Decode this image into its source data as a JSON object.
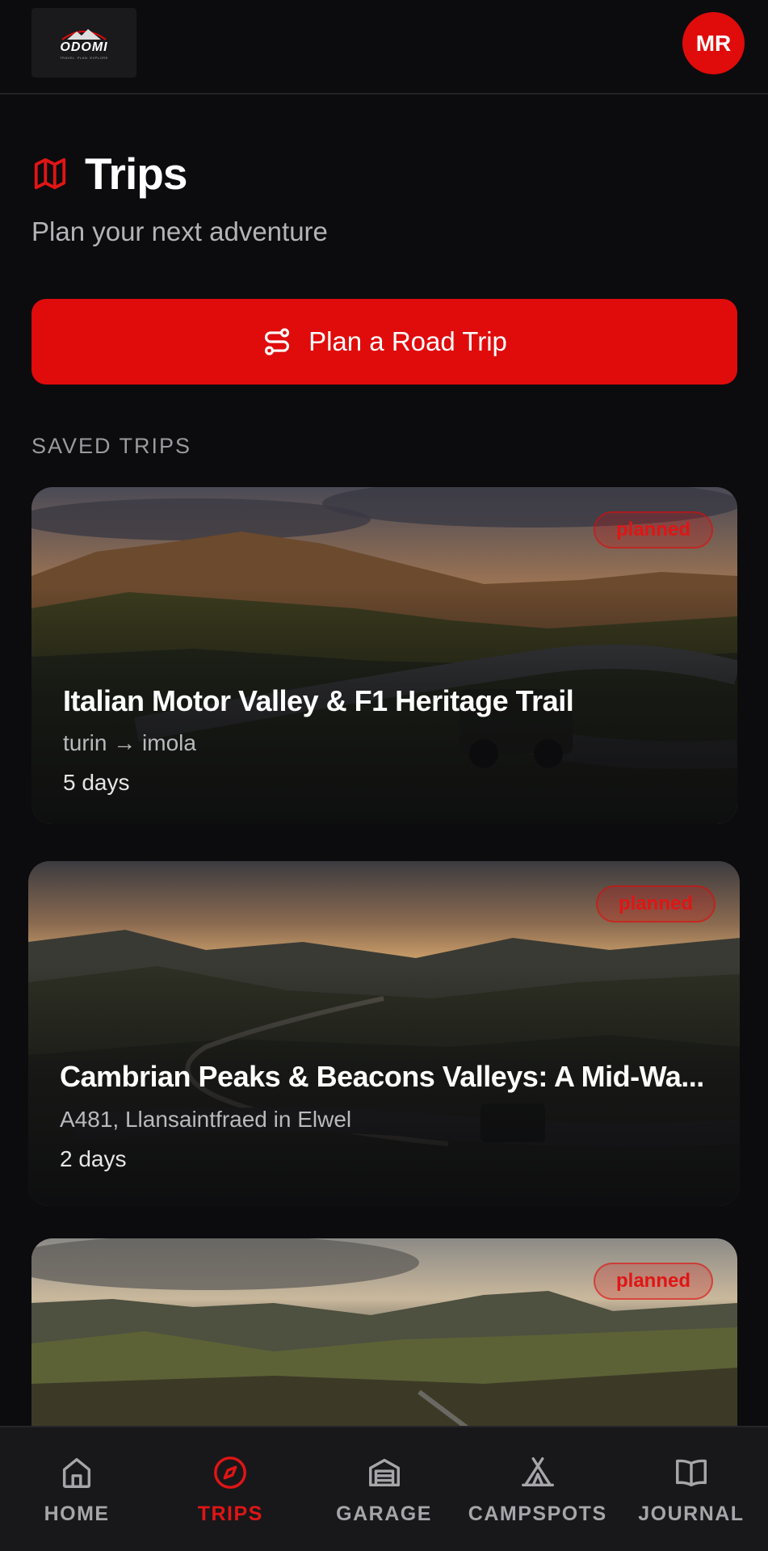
{
  "header": {
    "logo_text": "ODOMI",
    "logo_tagline": "TRAVEL. PLAN. EXPLORE",
    "avatar_initials": "MR"
  },
  "page": {
    "title": "Trips",
    "subtitle": "Plan your next adventure",
    "title_icon": "map-icon"
  },
  "cta": {
    "label": "Plan a Road Trip",
    "icon": "route-icon"
  },
  "section": {
    "label": "SAVED TRIPS"
  },
  "trips": [
    {
      "title": "Italian Motor Valley & F1 Heritage Trail",
      "route": "turin → imola",
      "duration": "5 days",
      "status": "planned"
    },
    {
      "title": "Cambrian Peaks & Beacons Valleys: A Mid-Wa...",
      "route": "A481, Llansaintfraed in Elwel",
      "duration": "2 days",
      "status": "planned"
    },
    {
      "title": "",
      "route": "",
      "duration": "",
      "status": "planned"
    }
  ],
  "nav": {
    "items": [
      {
        "label": "HOME",
        "icon": "home-icon",
        "active": false
      },
      {
        "label": "TRIPS",
        "icon": "compass-icon",
        "active": true
      },
      {
        "label": "GARAGE",
        "icon": "garage-icon",
        "active": false
      },
      {
        "label": "CAMPSPOTS",
        "icon": "tent-icon",
        "active": false
      },
      {
        "label": "JOURNAL",
        "icon": "book-icon",
        "active": false
      }
    ]
  },
  "colors": {
    "accent": "#e00b0b",
    "background": "#0c0c0e",
    "nav_background": "#18181b"
  }
}
